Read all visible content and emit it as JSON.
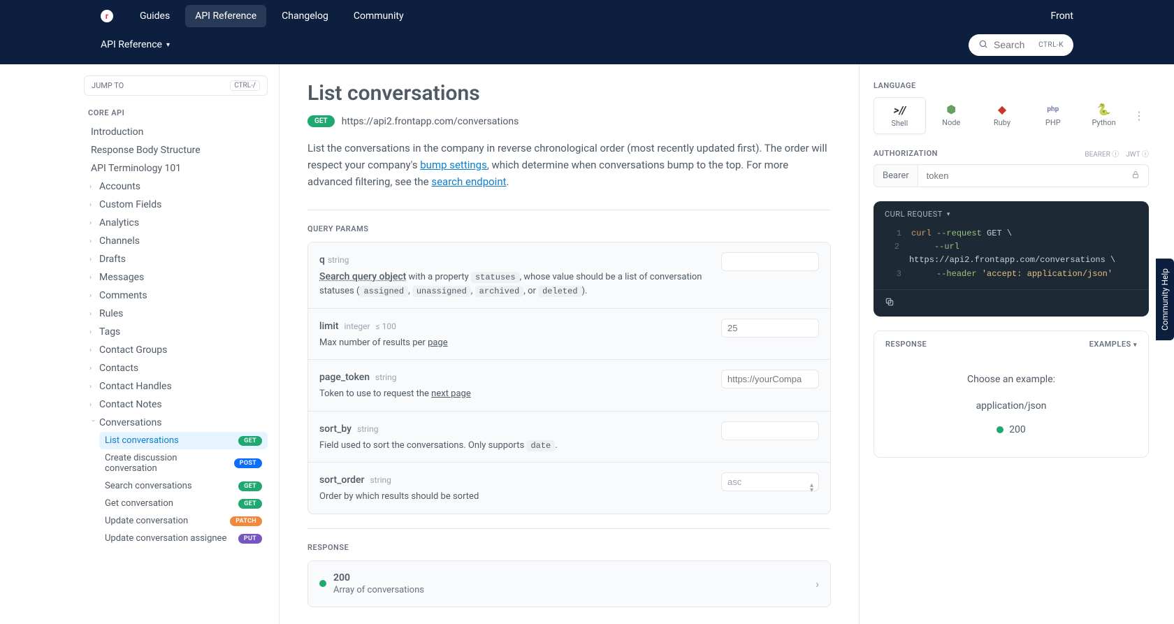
{
  "brand": "Front",
  "topnav": [
    "Guides",
    "API Reference",
    "Changelog",
    "Community"
  ],
  "topnav_active": 1,
  "subnav_label": "API Reference",
  "search": {
    "placeholder": "Search",
    "kbd": "CTRL-K"
  },
  "jump_to": {
    "label": "JUMP TO",
    "kbd": "CTRL-/"
  },
  "side_heading": "CORE API",
  "side_plain": [
    "Introduction",
    "Response Body Structure",
    "API Terminology 101"
  ],
  "side_groups": [
    "Accounts",
    "Custom Fields",
    "Analytics",
    "Channels",
    "Drafts",
    "Messages",
    "Comments",
    "Rules",
    "Tags",
    "Contact Groups",
    "Contacts",
    "Contact Handles",
    "Contact Notes"
  ],
  "side_conversations_label": "Conversations",
  "side_conversations": [
    {
      "label": "List conversations",
      "method": "GET",
      "selected": true
    },
    {
      "label": "Create discussion conversation",
      "method": "POST"
    },
    {
      "label": "Search conversations",
      "method": "GET"
    },
    {
      "label": "Get conversation",
      "method": "GET"
    },
    {
      "label": "Update conversation",
      "method": "PATCH"
    },
    {
      "label": "Update conversation assignee",
      "method": "PUT"
    }
  ],
  "page": {
    "title": "List conversations",
    "method": "GET",
    "url": "https://api2.frontapp.com/conversations",
    "desc1": "List the conversations in the company in reverse chronological order (most recently updated first). The order will respect your company's ",
    "link1": "bump settings",
    "desc2": ", which determine when conversations bump to the top. For more advanced filtering, see the ",
    "link2": "search endpoint",
    "desc3": "."
  },
  "query_params_label": "QUERY PARAMS",
  "params": {
    "q": {
      "name": "q",
      "type": "string",
      "d1": "Search query object",
      "d2": " with a property ",
      "c1": "statuses",
      "d3": ", whose value should be a list of conversation statuses (",
      "c2": "assigned",
      "c3": "unassigned",
      "c4": "archived",
      "c5": "deleted",
      "d4": ", or ",
      "d5": ")."
    },
    "limit": {
      "name": "limit",
      "type": "integer",
      "constraint": "≤ 100",
      "desc_a": "Max number of results per ",
      "desc_link": "page",
      "placeholder": "25"
    },
    "page_token": {
      "name": "page_token",
      "type": "string",
      "desc_a": "Token to use to request the ",
      "desc_link": "next page",
      "placeholder": "https://yourCompa"
    },
    "sort_by": {
      "name": "sort_by",
      "type": "string",
      "desc_a": "Field used to sort the conversations. Only supports ",
      "code": "date",
      "desc_b": "."
    },
    "sort_order": {
      "name": "sort_order",
      "type": "string",
      "desc": "Order by which results should be sorted",
      "value": "asc"
    }
  },
  "response_label": "RESPONSE",
  "response_row": {
    "code": "200",
    "sub": "Array of conversations"
  },
  "right": {
    "language_label": "LANGUAGE",
    "languages": [
      "Shell",
      "Node",
      "Ruby",
      "PHP",
      "Python"
    ],
    "auth_label": "AUTHORIZATION",
    "auth_tags": [
      "BEARER ⓘ",
      "JWT ⓘ"
    ],
    "auth_prefix": "Bearer",
    "auth_placeholder": "token",
    "code_head": "CURL REQUEST",
    "code": {
      "l1": {
        "cmd": "curl",
        "flag": "--request",
        "val": "GET",
        "cont": "\\"
      },
      "l2": {
        "flag": "--url",
        "val": "https://api2.frontapp.com/conversations",
        "cont": "\\"
      },
      "l3": {
        "flag": "--header",
        "str": "'accept: application/json'"
      }
    },
    "resp_label": "RESPONSE",
    "examples_label": "EXAMPLES",
    "choose": "Choose an example:",
    "mime": "application/json",
    "code200": "200"
  },
  "help_tab": "Community Help"
}
